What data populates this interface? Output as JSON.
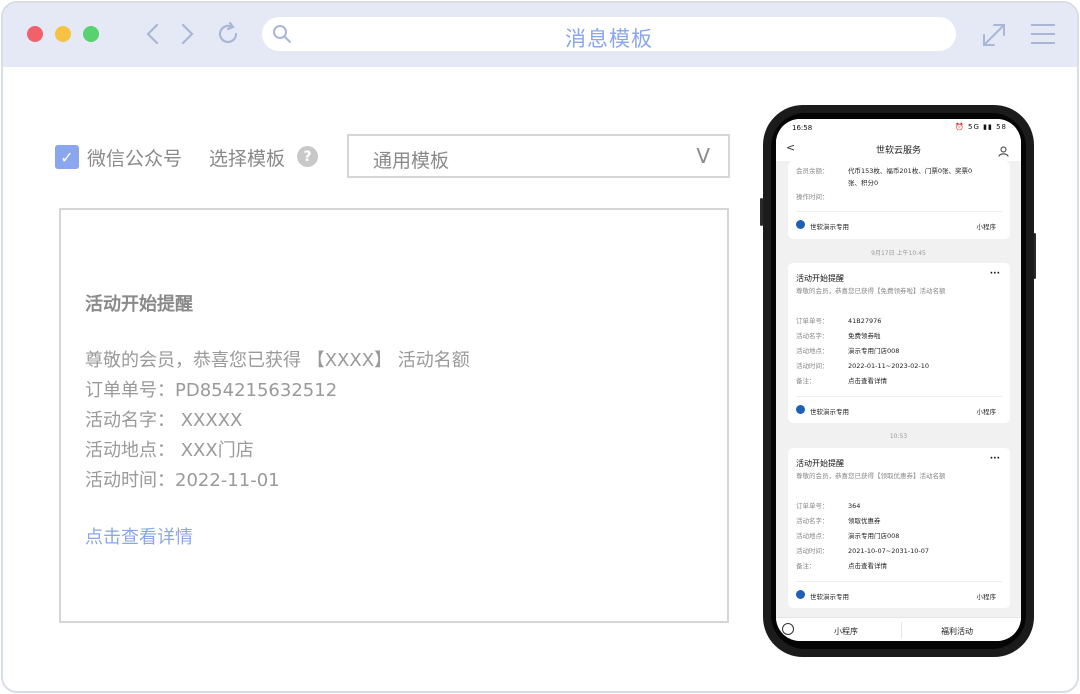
{
  "window": {
    "title": "消息模板"
  },
  "form": {
    "wechat_label": "微信公众号",
    "wechat_checked": true,
    "select_label": "选择模板",
    "help": "?",
    "template_value": "通用模板",
    "arrow": "V"
  },
  "preview": {
    "title": "活动开始提醒",
    "lines": [
      "尊敬的会员，恭喜您已获得 【XXXX】 活动名额",
      "订单单号：PD854215632512",
      "活动名字： XXXXX",
      "活动地点： XXX门店",
      "活动时间：2022-11-01"
    ],
    "link": "点击查看详情"
  },
  "phone": {
    "status": {
      "time": "16:58",
      "icons": "⏰ 5G ▮▮ 58"
    },
    "app_name": "世软云服务",
    "top_card": {
      "rows": [
        {
          "label": "会员余额：",
          "value": "代币153枚、福币201枚、门票0张、奖票0"
        },
        {
          "label": "",
          "value": "张、积分0"
        },
        {
          "label": "操作时间：",
          "value": ""
        }
      ],
      "footer_name": "世软演示专用",
      "footer_mini": "小程序"
    },
    "timestamp1": "9月17日 上午10:45",
    "card1": {
      "title": "活动开始提醒",
      "sub": "尊敬的会员，恭喜您已获得【免费领券啦】活动名额",
      "more": "···",
      "rows": [
        {
          "label": "订单单号：",
          "value": "41B27976"
        },
        {
          "label": "活动名字：",
          "value": "免费领券啦"
        },
        {
          "label": "活动地点：",
          "value": "演示专用门店008"
        },
        {
          "label": "活动时间：",
          "value": "2022-01-11~2023-02-10"
        },
        {
          "label": "备注：",
          "value": "点击查看详情"
        }
      ],
      "footer_name": "世软演示专用",
      "footer_mini": "小程序"
    },
    "timestamp2": "10:53",
    "card2": {
      "title": "活动开始提醒",
      "sub": "尊敬的会员，恭喜您已获得【领取优惠券】活动名额",
      "more": "···",
      "rows": [
        {
          "label": "订单单号：",
          "value": "364"
        },
        {
          "label": "活动名字：",
          "value": "领取优惠券"
        },
        {
          "label": "活动地点：",
          "value": "演示专用门店008"
        },
        {
          "label": "活动时间：",
          "value": "2021-10-07~2031-10-07"
        },
        {
          "label": "备注：",
          "value": "点击查看详情"
        }
      ],
      "footer_name": "世软演示专用",
      "footer_mini": "小程序"
    },
    "bottom": {
      "tab1": "小程序",
      "tab2": "福利活动"
    }
  },
  "colors": {
    "accent": "#8aa6ee",
    "titlebar": "#e4e9f5",
    "text": "#8a8a8a"
  }
}
